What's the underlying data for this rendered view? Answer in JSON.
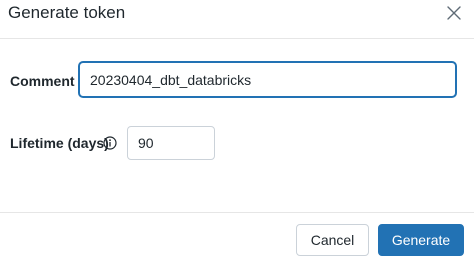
{
  "dialog": {
    "title": "Generate token",
    "close_icon": "close-icon"
  },
  "form": {
    "comment": {
      "label": "Comment",
      "value": "20230404_dbt_databricks"
    },
    "lifetime": {
      "label": "Lifetime (days)",
      "info_icon": "info-icon",
      "value": "90"
    }
  },
  "footer": {
    "cancel_label": "Cancel",
    "generate_label": "Generate"
  },
  "colors": {
    "primary": "#2272b4",
    "text": "#1f272d",
    "border": "#cbd2d9"
  }
}
